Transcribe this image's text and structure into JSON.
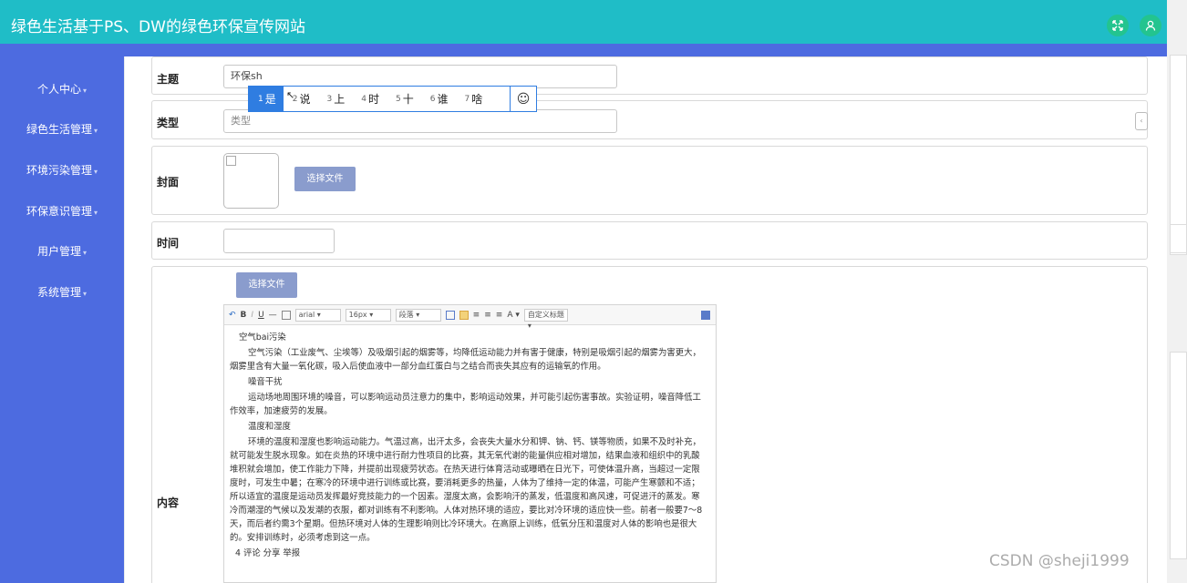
{
  "header": {
    "title": "绿色生活基于PS、DW的绿色环保宣传网站"
  },
  "sidebar": {
    "items": [
      "个人中心",
      "绿色生活管理",
      "环境污染管理",
      "环保意识管理",
      "用户管理",
      "系统管理"
    ]
  },
  "form": {
    "topic_label": "主题",
    "topic_value": "环保sh",
    "type_label": "类型",
    "type_placeholder": "类型",
    "cover_label": "封面",
    "file_button": "选择文件",
    "time_label": "时间",
    "content_label": "内容",
    "content_file_button": "选择文件"
  },
  "ime": {
    "candidates": [
      {
        "n": "1",
        "t": "是"
      },
      {
        "n": "2",
        "t": "说"
      },
      {
        "n": "3",
        "t": "上"
      },
      {
        "n": "4",
        "t": "时"
      },
      {
        "n": "5",
        "t": "十"
      },
      {
        "n": "6",
        "t": "谁"
      },
      {
        "n": "7",
        "t": "啥"
      }
    ],
    "emoji": "☺"
  },
  "editor": {
    "toolbar": {
      "bold": "B",
      "italic": "I",
      "underline": "U",
      "font_family": "arial",
      "font_size": "16px",
      "paragraph": "段落",
      "font_color": "A",
      "custom_title": "自定义标题"
    },
    "content": {
      "h1": "空气bai污染",
      "p1": "空气污染（工业废气、尘埃等）及吸烟引起的烟雾等，均降低运动能力并有害于健康，特别是吸烟引起的烟雾为害更大，烟雾里含有大量一氧化碳，吸入后使血液中一部分血红蛋白与之结合而丧失其应有的运输氧的作用。",
      "h2": "噪音干扰",
      "p2": "运动场地周围环境的噪音，可以影响运动员注意力的集中，影响运动效果，并可能引起伤害事故。实验证明，噪音降低工作效率，加速疲劳的发展。",
      "h3": "温度和湿度",
      "p3": "环境的温度和湿度也影响运动能力。气温过高，出汗太多，会丧失大量水分和钾、钠、钙、镁等物质，如果不及时补充，就可能发生脱水现象。如在炎热的环境中进行耐力性项目的比赛，其无氧代谢的能量供应相对增加，结果血液和组织中的乳酸堆积就会增加，使工作能力下降，并提前出现疲劳状态。在热天进行体育活动或曝晒在日光下，可使体温升高，当超过一定限度时，可发生中暑；在寒冷的环境中进行训练或比赛，要消耗更多的热量，人体为了维持一定的体温，可能产生寒颤和不适；所以适宜的温度是运动员发挥最好竞技能力的一个因素。湿度太高，会影响汗的蒸发，低温度和高风速，可促进汗的蒸发。寒冷而潮湿的气候以及发潮的衣服，都对训练有不利影响。人体对热环境的适应，要比对冷环境的适应快一些。前者一般要7～8天，而后者约需3个星期。但热环境对人体的生理影响则比冷环境大。在高原上训练，低氧分压和温度对人体的影响也是很大的。安排训练时，必须考虑到这一点。",
      "footer": "4   评论 分享 举报"
    }
  },
  "watermark": "CSDN @sheji1999",
  "colors": {
    "header": "#1fbdc7",
    "sidebar": "#4d6be0",
    "icon_bg": "#23c48f",
    "ime_accent": "#2f7de1"
  }
}
